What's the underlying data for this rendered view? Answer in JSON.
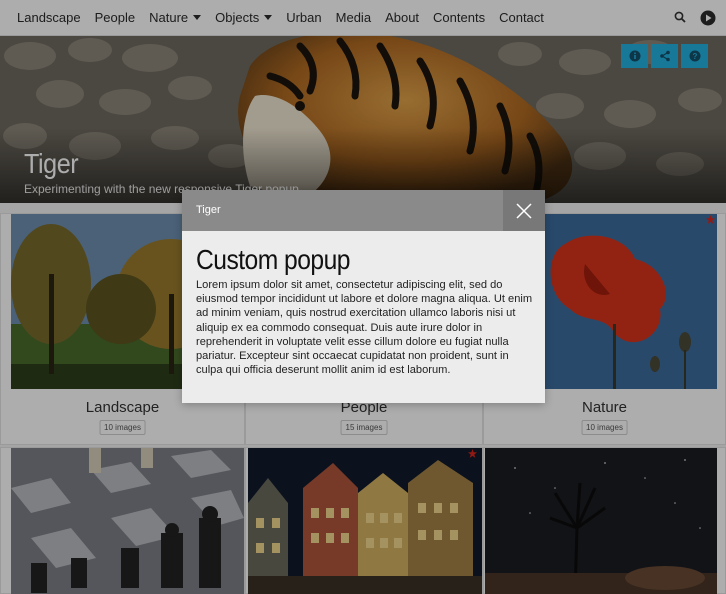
{
  "nav": {
    "items": [
      {
        "label": "Landscape",
        "dropdown": false
      },
      {
        "label": "People",
        "dropdown": false
      },
      {
        "label": "Nature",
        "dropdown": true
      },
      {
        "label": "Objects",
        "dropdown": true
      },
      {
        "label": "Urban",
        "dropdown": false
      },
      {
        "label": "Media",
        "dropdown": false
      },
      {
        "label": "About",
        "dropdown": false
      },
      {
        "label": "Contents",
        "dropdown": false
      },
      {
        "label": "Contact",
        "dropdown": false
      }
    ],
    "icons": [
      "search-icon",
      "play-icon"
    ]
  },
  "hero": {
    "title": "Tiger",
    "subtitle": "Experimenting with the new responsive Tiger popup...",
    "buttons": [
      "info-icon",
      "share-icon",
      "help-icon"
    ],
    "button_color": "#22b2e0"
  },
  "grid": {
    "cards": [
      {
        "title": "Landscape",
        "count": "10 images",
        "starred": false
      },
      {
        "title": "People",
        "count": "15 images",
        "starred": false
      },
      {
        "title": "Nature",
        "count": "10 images",
        "starred": true
      },
      {
        "title": "",
        "count": "",
        "starred": false
      },
      {
        "title": "",
        "count": "",
        "starred": true
      },
      {
        "title": "",
        "count": "",
        "starred": false
      }
    ],
    "star_color": "#d9261c"
  },
  "popup": {
    "header_title": "Tiger",
    "heading": "Custom popup",
    "body": "Lorem ipsum dolor sit amet, consectetur adipiscing elit, sed do eiusmod tempor incididunt ut labore et dolore magna aliqua. Ut enim ad minim veniam, quis nostrud exercitation ullamco laboris nisi ut aliquip ex ea commodo consequat. Duis aute irure dolor in reprehenderit in voluptate velit esse cillum dolore eu fugiat nulla pariatur. Excepteur sint occaecat cupidatat non proident, sunt in culpa qui officia deserunt mollit anim id est laborum."
  }
}
